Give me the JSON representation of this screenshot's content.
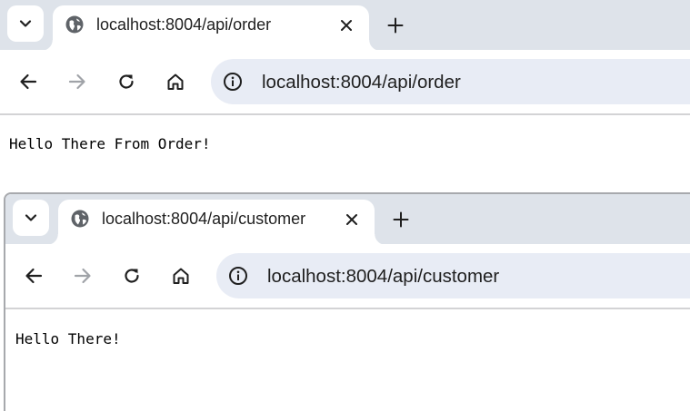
{
  "windows": [
    {
      "tab": {
        "title": "localhost:8004/api/order"
      },
      "address_bar": {
        "url": "localhost:8004/api/order"
      },
      "page": {
        "body_text": "Hello There From Order!"
      }
    },
    {
      "tab": {
        "title": "localhost:8004/api/customer"
      },
      "address_bar": {
        "url": "localhost:8004/api/customer"
      },
      "page": {
        "body_text": "Hello There!"
      }
    }
  ],
  "icons": {
    "tab_search": "chevron-down-icon",
    "favicon": "globe-icon",
    "tab_close": "close-icon",
    "new_tab": "plus-icon",
    "back": "arrow-left-icon",
    "forward": "arrow-right-icon",
    "reload": "reload-icon",
    "home": "home-icon",
    "site_info": "info-icon"
  },
  "colors": {
    "tabstrip": "#dee3ea",
    "omnibox": "#e8ecf5",
    "icon": "#1f1f1f",
    "disabled_icon": "#a0a3a8"
  }
}
